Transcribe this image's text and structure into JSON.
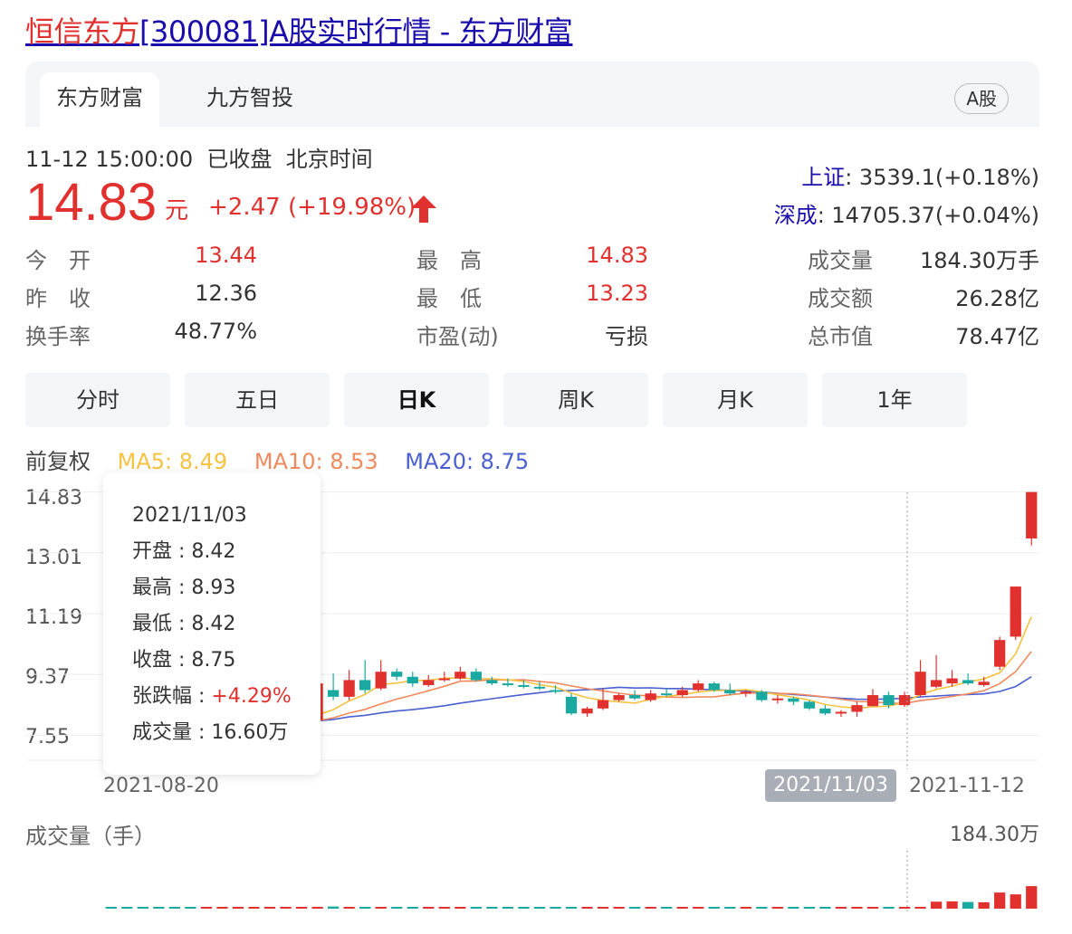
{
  "title": {
    "highlight": "恒信东方",
    "rest": "[300081]A股实时行情 - 东方财富"
  },
  "tabs": [
    {
      "label": "东方财富",
      "active": true
    },
    {
      "label": "九方智投",
      "active": false
    }
  ],
  "market_badge": "A股",
  "status_text": "11-12 15:00:00  已收盘  北京时间",
  "price": "14.83",
  "price_unit": "元",
  "change": "+2.47 (+19.98%)",
  "indices": [
    {
      "name": "上证",
      "value": ": 3539.1(+0.18%)"
    },
    {
      "name": "深成",
      "value": ": 14705.37(+0.04%)"
    }
  ],
  "stats": [
    {
      "label": "今　开",
      "value": "13.44",
      "color": "red"
    },
    {
      "label": "最　高",
      "value": "14.83",
      "color": "red"
    },
    {
      "label": "成交量",
      "value": "184.30万手",
      "color": "dark"
    },
    {
      "label": "昨　收",
      "value": "12.36",
      "color": "dark"
    },
    {
      "label": "最　低",
      "value": "13.23",
      "color": "red"
    },
    {
      "label": "成交额",
      "value": "26.28亿",
      "color": "dark"
    },
    {
      "label": "换手率",
      "value": "48.77%",
      "color": "dark"
    },
    {
      "label": "市盈(动)",
      "value": "亏损",
      "color": "dark"
    },
    {
      "label": "总市值",
      "value": "78.47亿",
      "color": "dark"
    }
  ],
  "periods": [
    {
      "label": "分时",
      "active": false
    },
    {
      "label": "五日",
      "active": false
    },
    {
      "label": "日K",
      "active": true
    },
    {
      "label": "周K",
      "active": false
    },
    {
      "label": "月K",
      "active": false
    },
    {
      "label": "1年",
      "active": false
    }
  ],
  "adjust": "前复权",
  "ma": [
    {
      "label": "MA5: 8.49",
      "color": "#f5c242"
    },
    {
      "label": "MA10: 8.53",
      "color": "#f08a5d"
    },
    {
      "label": "MA20: 8.75",
      "color": "#4a5fd0"
    }
  ],
  "colors": {
    "up": "#e0312e",
    "down": "#1aa9a0",
    "ma5": "#f5c242",
    "ma10": "#f08a5d",
    "ma20": "#4a5fd0"
  },
  "tooltip": {
    "date": "2021/11/03",
    "rows": [
      {
        "label": "开盘 : ",
        "value": "8.42",
        "red": false
      },
      {
        "label": "最高 : ",
        "value": "8.93",
        "red": false
      },
      {
        "label": "最低 : ",
        "value": "8.42",
        "red": false
      },
      {
        "label": "收盘 : ",
        "value": "8.75",
        "red": false
      },
      {
        "label": "张跌幅 : ",
        "value": "+4.29%",
        "red": true
      },
      {
        "label": "成交量 : ",
        "value": "16.60万",
        "red": false
      }
    ]
  },
  "x_axis": {
    "start": "2021-08-20",
    "cross": "2021/11/03",
    "end": "2021-11-12"
  },
  "volume_label": "成交量（手）",
  "volume_max": "184.30万",
  "chart_data": {
    "type": "candlestick",
    "y_ticks": [
      "14.83",
      "13.01",
      "11.19",
      "9.37",
      "7.55"
    ],
    "ylim": [
      6.8,
      15.2
    ],
    "candles": [
      [
        8.3,
        8.1,
        8.35,
        8.05
      ],
      [
        8.15,
        8.0,
        8.2,
        7.95
      ],
      [
        8.0,
        7.9,
        8.05,
        7.85
      ],
      [
        7.9,
        7.85,
        7.95,
        7.8
      ],
      [
        7.85,
        7.8,
        7.9,
        7.75
      ],
      [
        7.8,
        7.78,
        7.85,
        7.72
      ],
      [
        7.78,
        7.8,
        7.85,
        7.7
      ],
      [
        7.8,
        7.82,
        7.88,
        7.75
      ],
      [
        7.82,
        7.85,
        7.9,
        7.78
      ],
      [
        7.85,
        7.88,
        7.92,
        7.8
      ],
      [
        7.88,
        7.9,
        7.95,
        7.82
      ],
      [
        7.9,
        7.92,
        7.98,
        7.85
      ],
      [
        7.92,
        7.95,
        8.0,
        7.88
      ],
      [
        8.0,
        9.1,
        9.2,
        7.95
      ],
      [
        8.9,
        8.7,
        9.4,
        8.6
      ],
      [
        8.7,
        9.2,
        9.5,
        8.6
      ],
      [
        9.2,
        8.9,
        9.8,
        8.8
      ],
      [
        8.95,
        9.45,
        9.8,
        8.9
      ],
      [
        9.45,
        9.3,
        9.55,
        9.2
      ],
      [
        9.3,
        9.1,
        9.45,
        9.0
      ],
      [
        9.05,
        9.2,
        9.35,
        9.0
      ],
      [
        9.2,
        9.25,
        9.45,
        9.15
      ],
      [
        9.25,
        9.45,
        9.6,
        9.2
      ],
      [
        9.45,
        9.2,
        9.55,
        9.15
      ],
      [
        9.2,
        9.1,
        9.3,
        9.05
      ],
      [
        9.1,
        9.05,
        9.25,
        9.0
      ],
      [
        9.05,
        9.0,
        9.2,
        8.95
      ],
      [
        9.0,
        8.95,
        9.15,
        8.9
      ],
      [
        8.9,
        8.85,
        9.05,
        8.8
      ],
      [
        8.7,
        8.2,
        8.8,
        8.15
      ],
      [
        8.2,
        8.35,
        8.4,
        8.1
      ],
      [
        8.35,
        8.6,
        8.95,
        8.3
      ],
      [
        8.6,
        8.75,
        8.8,
        8.55
      ],
      [
        8.75,
        8.65,
        8.9,
        8.6
      ],
      [
        8.6,
        8.8,
        8.9,
        8.55
      ],
      [
        8.8,
        8.75,
        8.95,
        8.7
      ],
      [
        8.75,
        8.9,
        9.0,
        8.7
      ],
      [
        8.9,
        9.1,
        9.2,
        8.85
      ],
      [
        9.1,
        8.9,
        9.15,
        8.85
      ],
      [
        8.9,
        8.8,
        9.1,
        8.75
      ],
      [
        8.8,
        8.85,
        8.9,
        8.7
      ],
      [
        8.85,
        8.6,
        8.9,
        8.55
      ],
      [
        8.6,
        8.65,
        8.75,
        8.5
      ],
      [
        8.65,
        8.55,
        8.7,
        8.45
      ],
      [
        8.55,
        8.35,
        8.6,
        8.3
      ],
      [
        8.35,
        8.2,
        8.45,
        8.15
      ],
      [
        8.2,
        8.25,
        8.3,
        8.1
      ],
      [
        8.25,
        8.45,
        8.55,
        8.1
      ],
      [
        8.42,
        8.75,
        8.93,
        8.42
      ],
      [
        8.75,
        8.45,
        8.85,
        8.35
      ],
      [
        8.45,
        8.75,
        8.85,
        8.4
      ],
      [
        8.75,
        9.45,
        9.8,
        8.7
      ],
      [
        9.0,
        9.2,
        9.95,
        8.95
      ],
      [
        9.1,
        9.25,
        9.5,
        9.0
      ],
      [
        9.2,
        9.1,
        9.4,
        9.05
      ],
      [
        9.05,
        9.15,
        9.3,
        9.0
      ],
      [
        9.6,
        10.4,
        10.5,
        9.5
      ],
      [
        10.5,
        12.0,
        12.0,
        10.4
      ],
      [
        13.44,
        14.83,
        14.83,
        13.23
      ]
    ],
    "volume": [
      2,
      2,
      2,
      2,
      2,
      2,
      2,
      2,
      2,
      2,
      2,
      2,
      3,
      6,
      7,
      6,
      5,
      5,
      4,
      3,
      3,
      3,
      3,
      2,
      2,
      2,
      2,
      2,
      2,
      2,
      2,
      3,
      3,
      2,
      2,
      2,
      2,
      2,
      2,
      2,
      2,
      2,
      2,
      2,
      2,
      2,
      2,
      3,
      4,
      2,
      3,
      6,
      23,
      24,
      22,
      21,
      53,
      47,
      74
    ],
    "volume_max": 184.3
  }
}
